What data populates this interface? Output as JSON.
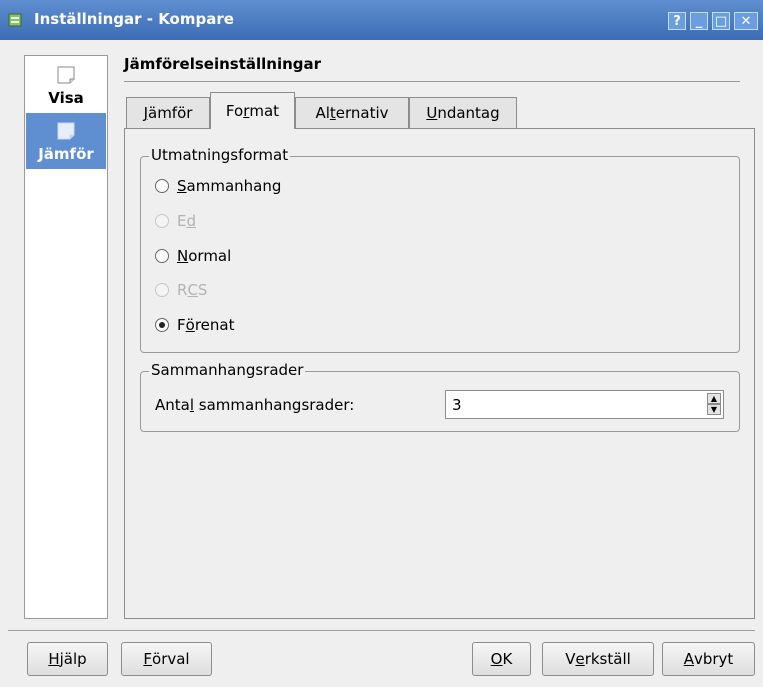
{
  "window": {
    "title": "Inställningar - Kompare",
    "buttons": [
      "?",
      "_",
      "□",
      "✕"
    ]
  },
  "sidebar": {
    "items": [
      {
        "label": "Visa",
        "selected": false,
        "icon": "page-icon"
      },
      {
        "label": "Jämför",
        "selected": true,
        "icon": "page-icon"
      }
    ]
  },
  "header": {
    "title": "Jämförelseinställningar"
  },
  "tabs": [
    {
      "pre": "",
      "mn": "J",
      "post": "ämför",
      "active": false
    },
    {
      "pre": "Fo",
      "mn": "r",
      "post": "mat",
      "active": true
    },
    {
      "pre": "Al",
      "mn": "t",
      "post": "ernativ",
      "active": false
    },
    {
      "pre": "",
      "mn": "U",
      "post": "ndantag",
      "active": false
    }
  ],
  "output_format": {
    "title": "Utmatningsformat",
    "options": [
      {
        "pre": "",
        "mn": "S",
        "post": "ammanhang",
        "checked": false,
        "enabled": true
      },
      {
        "pre": "E",
        "mn": "d",
        "post": "",
        "checked": false,
        "enabled": false
      },
      {
        "pre": "",
        "mn": "N",
        "post": "ormal",
        "checked": false,
        "enabled": true
      },
      {
        "pre": "R",
        "mn": "C",
        "post": "S",
        "checked": false,
        "enabled": false
      },
      {
        "pre": "F",
        "mn": "ö",
        "post": "renat",
        "checked": true,
        "enabled": true
      }
    ]
  },
  "context_lines": {
    "title": "Sammanhangsrader",
    "label_pre": "Anta",
    "label_mn": "l",
    "label_post": " sammanhangsrader:",
    "value": "3"
  },
  "buttons": {
    "help": {
      "pre": "",
      "mn": "H",
      "post": "jälp"
    },
    "defaults": {
      "pre": "",
      "mn": "F",
      "post": "örval"
    },
    "ok": {
      "pre": "",
      "mn": "O",
      "post": "K"
    },
    "apply": {
      "pre": "V",
      "mn": "e",
      "post": "rkställ"
    },
    "cancel": {
      "pre": "",
      "mn": "A",
      "post": "vbryt"
    }
  },
  "colors": {
    "titlebar": "#4a7cc4",
    "selection": "#5f8fd0",
    "background": "#efefef"
  }
}
